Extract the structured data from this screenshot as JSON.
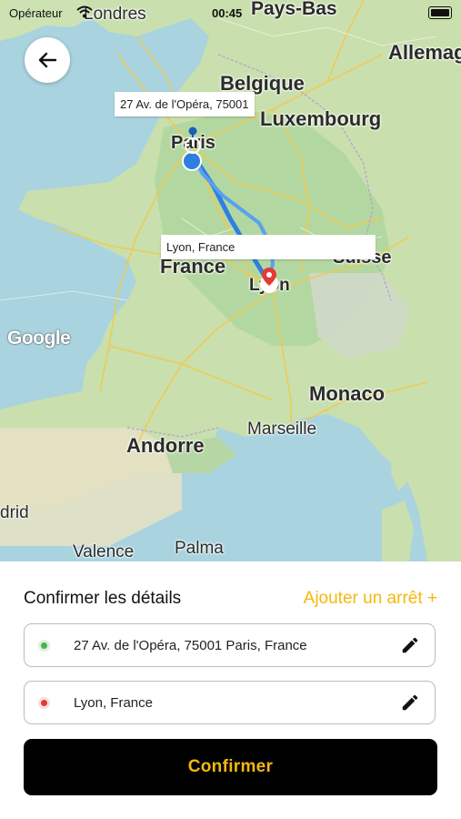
{
  "status_bar": {
    "carrier": "Opérateur",
    "time": "00:45"
  },
  "map": {
    "labels": {
      "londres": "Londres",
      "paysbas": "Pays-Bas",
      "allemagne": "Allemag",
      "belgique": "Belgique",
      "luxembourg": "Luxembourg",
      "paris": "Paris",
      "france": "France",
      "lyon": "Lyon",
      "suisse": "Suisse",
      "monaco": "Monaco",
      "marseille": "Marseille",
      "andorre": "Andorre",
      "madrid": "drid",
      "valence": "Valence",
      "palma": "Palma"
    },
    "callouts": {
      "origin": "27 Av. de l'Opéra, 75001",
      "destination": "Lyon, France"
    },
    "google_logo": "Google"
  },
  "panel": {
    "title": "Confirmer les détails",
    "add_stop": "Ajouter un arrêt +",
    "origin": {
      "text": "27 Av. de l'Opéra, 75001 Paris, France",
      "dot_color": "#4caf50"
    },
    "destination": {
      "text": "Lyon, France",
      "dot_color": "#e53935"
    },
    "confirm_label": "Confirmer"
  },
  "colors": {
    "accent": "#f3b80f",
    "route": "#2f7fe0",
    "button_bg": "#000000"
  }
}
